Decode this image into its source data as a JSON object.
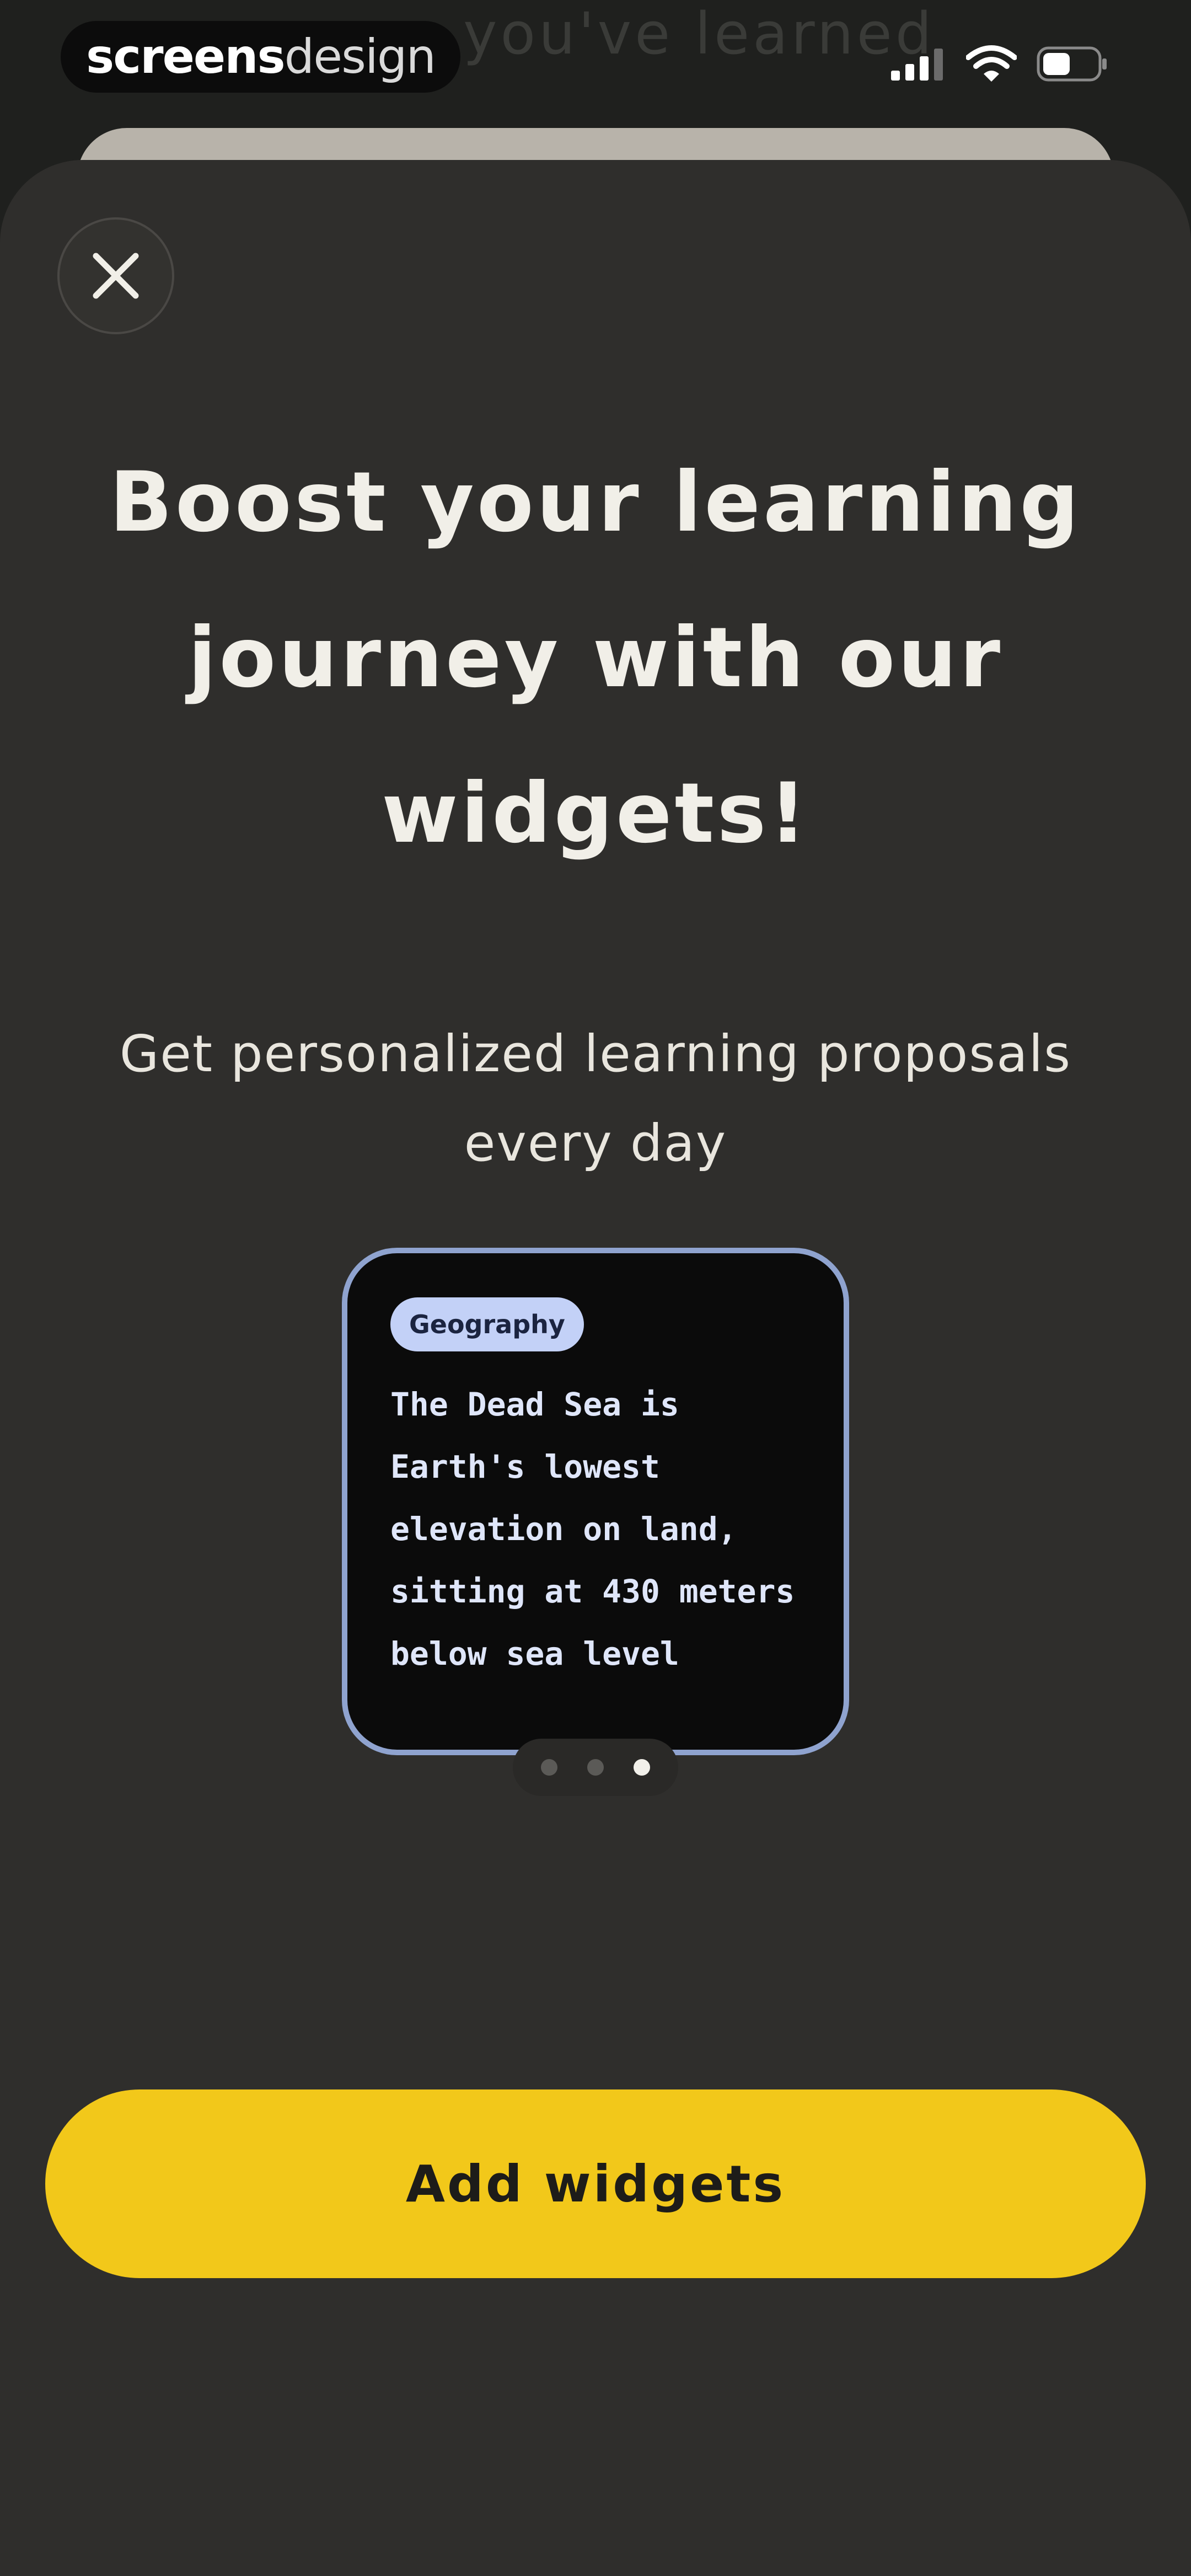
{
  "watermark": {
    "bold": "screens",
    "light": "design"
  },
  "background": {
    "title": "you've learned"
  },
  "status_bar": {
    "icons": [
      "cellular-signal-icon",
      "wifi-icon",
      "battery-icon"
    ]
  },
  "modal": {
    "close_icon": "close-icon",
    "headline": "Boost your learning journey with our widgets!",
    "subtitle": "Get personalized learning proposals every day",
    "widget": {
      "tag": "Geography",
      "text": "The Dead Sea is Earth's lowest elevation on land, sitting at 430 meters below sea level"
    },
    "pagination": {
      "count": 3,
      "active_index": 2
    },
    "cta_label": "Add widgets"
  },
  "colors": {
    "sheet_bg": "#2f2e2c",
    "accent": "#f2c81a",
    "widget_border": "#8fa3cf",
    "tag_bg": "#c3d1f7"
  }
}
